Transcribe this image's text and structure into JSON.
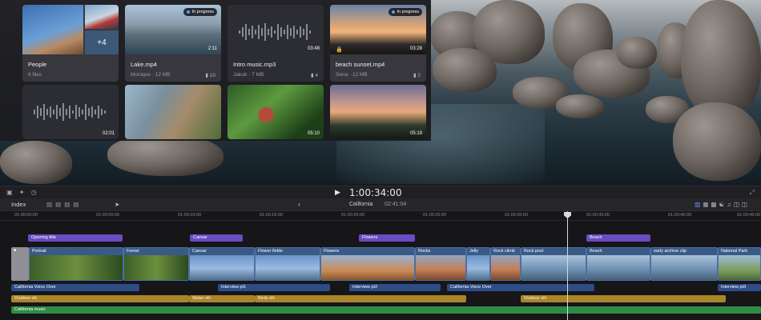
{
  "media": {
    "cards": [
      {
        "name": "People",
        "meta": "6 files",
        "more": "+4"
      },
      {
        "name": "Lake.mp4",
        "meta": "Monique · 12 MB",
        "badge": "In progress",
        "duration": "2:11",
        "comments": "10"
      },
      {
        "name": "Intro music.mp3",
        "meta": "Jakub · 7 MB",
        "duration": "03:48",
        "comments": "4"
      },
      {
        "name": "beach sunset.mp4",
        "meta": "Sena · 12 MB",
        "badge": "In progress",
        "duration": "03:28",
        "comments": "2"
      },
      {
        "duration": "02:01"
      },
      {},
      {
        "duration": "05:10"
      },
      {
        "duration": "05:19"
      }
    ]
  },
  "playback": {
    "timecode": "1:00:34:00"
  },
  "timeline": {
    "index_label": "Index",
    "project_name": "California",
    "project_duration": "02:41:04",
    "ruler_ticks": [
      "01:00:00:00",
      "01:00:05:00",
      "01:00:10:00",
      "01:00:15:00",
      "01:00:20:00",
      "01:00:25:00",
      "01:00:30:00",
      "01:00:35:00",
      "01:00:40:00",
      "01:00:45:00"
    ],
    "title_clips": [
      "Opening title",
      "Caesar",
      "Flowers",
      "Beach"
    ],
    "video_clips": [
      "Portrait",
      "Forest",
      "Caesar",
      "Flower fields",
      "Flowers",
      "Rocks",
      "Jelly",
      "Rock climb",
      "Rock pool",
      "Beach",
      "early archive clip",
      "National Park"
    ],
    "voiceover_clips": [
      "California Voice Over",
      "Interview pt1",
      "Interview pt2",
      "California Voice Over",
      "Interview pt3"
    ],
    "sfx_clips": [
      "Outdoor sfx",
      "Water sfx",
      "Birds sfx",
      "Outdoor sfx"
    ],
    "music_clip": "California music"
  },
  "colors": {
    "title_clip": "#6a4bc2",
    "voiceover_clip": "#2e4c86",
    "sfx_clip": "#a9852a",
    "music_clip": "#2e8a45",
    "badge_dot": "#5aa0ff"
  }
}
